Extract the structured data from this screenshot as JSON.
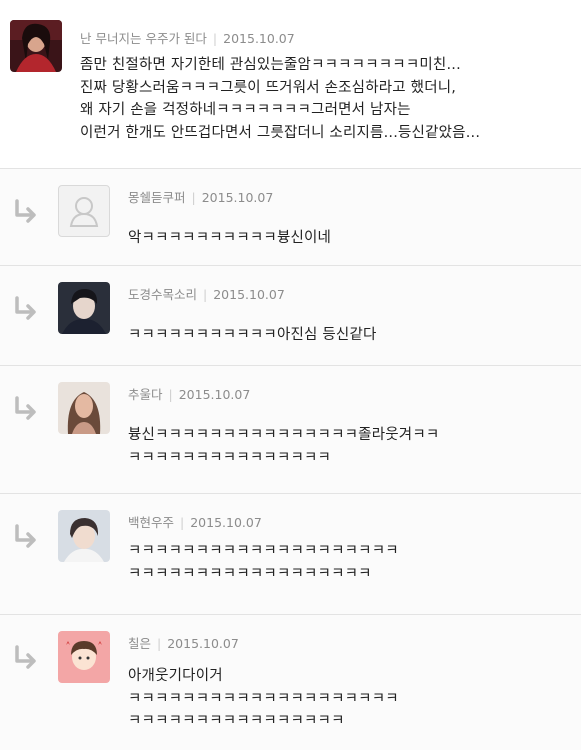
{
  "comments": [
    {
      "nickname": "난 무너지는 우주가 된다",
      "date": "2015.10.07",
      "text": "좀만 친절하면 자기한테 관심있는줄암ㅋㅋㅋㅋㅋㅋㅋㅋ미친...\n진짜 당황스러움ㅋㅋㅋ그릇이 뜨거워서 손조심하라고 했더니,\n왜 자기 손을 걱정하네ㅋㅋㅋㅋㅋㅋㅋ그러면서 남자는\n이런거 한개도 안뜨겁다면서 그릇잡더니 소리지름...등신같았음..."
    },
    {
      "nickname": "몽쉘듣쿠퍼",
      "date": "2015.10.07",
      "text": "악ㅋㅋㅋㅋㅋㅋㅋㅋㅋㅋ븅신이네"
    },
    {
      "nickname": "도경수목소리",
      "date": "2015.10.07",
      "text": "ㅋㅋㅋㅋㅋㅋㅋㅋㅋㅋㅋ아진심 등신같다"
    },
    {
      "nickname": "추울다",
      "date": "2015.10.07",
      "text": "븅신ㅋㅋㅋㅋㅋㅋㅋㅋㅋㅋㅋㅋㅋㅋㅋ졸라웃겨ㅋㅋ\nㅋㅋㅋㅋㅋㅋㅋㅋㅋㅋㅋㅋㅋㅋㅋ"
    },
    {
      "nickname": "백현우주",
      "date": "2015.10.07",
      "text": "ㅋㅋㅋㅋㅋㅋㅋㅋㅋㅋㅋㅋㅋㅋㅋㅋㅋㅋㅋㅋ\nㅋㅋㅋㅋㅋㅋㅋㅋㅋㅋㅋㅋㅋㅋㅋㅋㅋㅋ"
    },
    {
      "nickname": "칠은",
      "date": "2015.10.07",
      "text": "아개웃기다이거\nㅋㅋㅋㅋㅋㅋㅋㅋㅋㅋㅋㅋㅋㅋㅋㅋㅋㅋㅋㅋ\nㅋㅋㅋㅋㅋㅋㅋㅋㅋㅋㅋㅋㅋㅋㅋㅋ"
    }
  ],
  "icons": {
    "reply": "reply-arrow-icon",
    "default_avatar": "default-profile-icon"
  },
  "colors": {
    "meta_text": "#8c8c8c",
    "separator": "#e3e3e3",
    "reply_arrow": "#bdbdbd"
  }
}
